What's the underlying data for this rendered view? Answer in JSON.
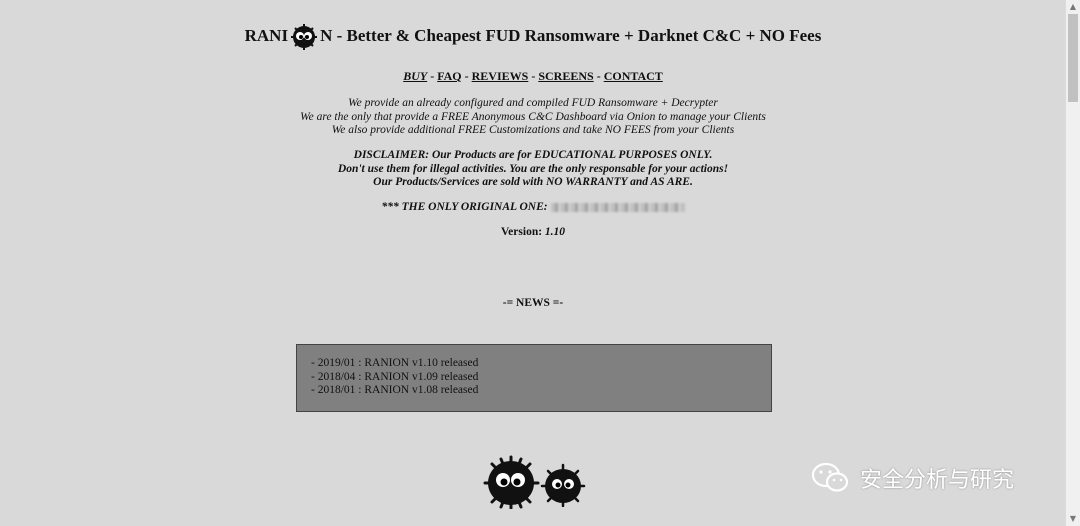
{
  "header": {
    "title_prefix": "RANI",
    "title_suffix": "N - Better & Cheapest FUD Ransomware + Darknet C&C + NO Fees"
  },
  "nav": {
    "items": [
      "BUY",
      "FAQ",
      "REVIEWS",
      "SCREENS",
      "CONTACT"
    ],
    "separator": "-"
  },
  "intro": {
    "lines": [
      "We provide an already configured and compiled FUD Ransomware + Decrypter",
      "We are the only that provide a FREE Anonymous C&C Dashboard via Onion to manage your Clients",
      "We also provide additional FREE Customizations and take NO FEES from your Clients"
    ]
  },
  "disclaimer": {
    "lines": [
      "DISCLAIMER: Our Products are for EDUCATIONAL PURPOSES ONLY.",
      "Don't use them for illegal activities. You are the only responsable for your actions!",
      "Our Products/Services are sold with NO WARRANTY and AS ARE."
    ]
  },
  "original": {
    "label": "*** THE ONLY ORIGINAL ONE:"
  },
  "version": {
    "label": "Version:",
    "value": "1.10"
  },
  "news": {
    "heading": "-= NEWS =-",
    "items": [
      "- 2019/01 : RANION v1.10 released",
      "- 2018/04 : RANION v1.09 released",
      "- 2018/01 : RANION v1.08 released"
    ]
  },
  "watermark": {
    "text": "安全分析与研究",
    "icon": "wechat-icon"
  },
  "colors": {
    "background": "#d9d9d9",
    "news_box": "#808080",
    "text": "#111111"
  }
}
